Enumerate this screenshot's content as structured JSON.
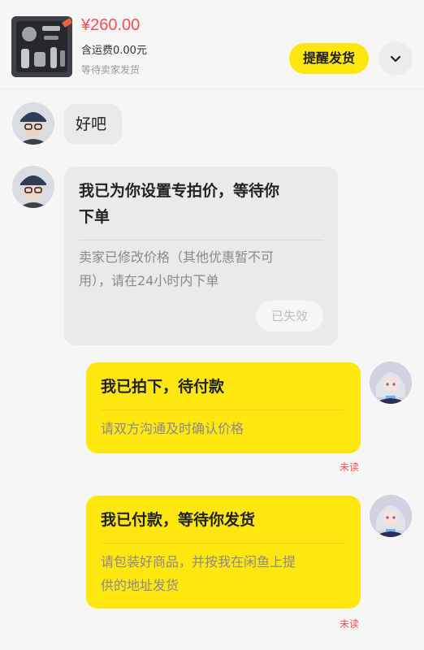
{
  "order": {
    "price": "¥260.00",
    "shipping": "含运费0.00元",
    "status": "等待卖家发货",
    "remind_button": "提醒发货",
    "expand_icon": "chevron-down-icon"
  },
  "messages": [
    {
      "side": "left",
      "text": "好吧"
    },
    {
      "side": "left",
      "title_line1": "我已为你设置专拍价，等待你",
      "title_line2": "下单",
      "desc_line1": "卖家已修改价格（其他优惠暂不可",
      "desc_line2": "用），请在24小时内下单",
      "tag": "已失效"
    },
    {
      "side": "right",
      "title": "我已拍下，待付款",
      "desc": "请双方沟通及时确认价格",
      "read_status": "未读"
    },
    {
      "side": "right",
      "title": "我已付款，等待你发货",
      "desc_line1": "请包装好商品，并按我在闲鱼上提",
      "desc_line2": "供的地址发货",
      "read_status": "未读"
    }
  ],
  "colors": {
    "accent": "#ffe60f",
    "price": "#ff4d4f",
    "bubble_gray": "#eaeaea"
  }
}
